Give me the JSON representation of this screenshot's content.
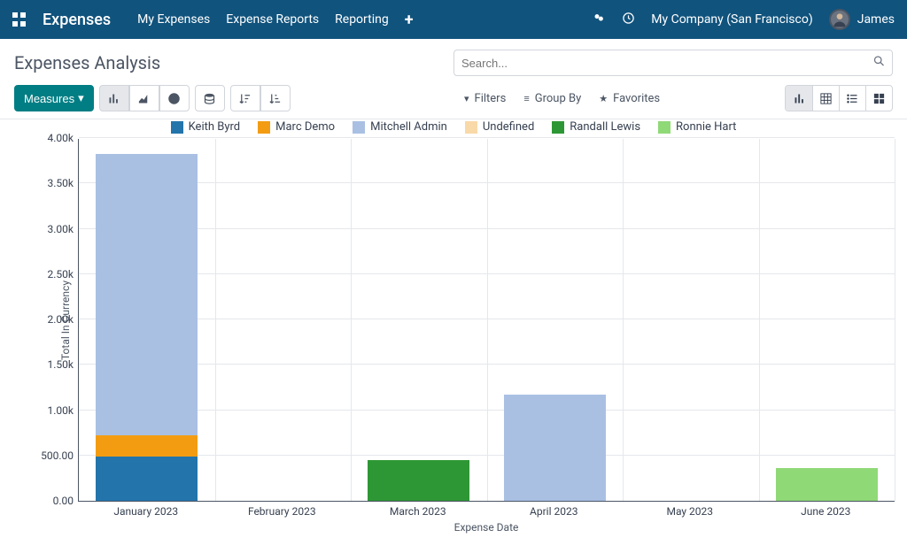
{
  "topnav": {
    "brand": "Expenses",
    "links": [
      "My Expenses",
      "Expense Reports",
      "Reporting"
    ],
    "company": "My Company (San Francisco)",
    "user": "James"
  },
  "controlpanel": {
    "title": "Expenses Analysis",
    "search_placeholder": "Search...",
    "measures_label": "Measures",
    "filters_label": "Filters",
    "groupby_label": "Group By",
    "favorites_label": "Favorites"
  },
  "colors": {
    "keith_byrd": "#2374ab",
    "marc_demo": "#f39c12",
    "mitchell_admin": "#a9c0e3",
    "undefined": "#f9d9a8",
    "randall_lewis": "#2e9735",
    "ronnie_hart": "#90d977"
  },
  "chart_data": {
    "type": "bar",
    "stacked": true,
    "title": "",
    "xlabel": "Expense Date",
    "ylabel": "Total In Currency",
    "ylim": [
      0,
      4000
    ],
    "ytick_step": 500,
    "ytick_labels": [
      "0.00",
      "500.00",
      "1.00k",
      "1.50k",
      "2.00k",
      "2.50k",
      "3.00k",
      "3.50k",
      "4.00k"
    ],
    "categories": [
      "January 2023",
      "February 2023",
      "March 2023",
      "April 2023",
      "May 2023",
      "June 2023"
    ],
    "series": [
      {
        "name": "Keith Byrd",
        "color_key": "keith_byrd",
        "values": [
          490,
          0,
          0,
          0,
          0,
          0
        ]
      },
      {
        "name": "Marc Demo",
        "color_key": "marc_demo",
        "values": [
          230,
          0,
          0,
          0,
          0,
          0
        ]
      },
      {
        "name": "Mitchell Admin",
        "color_key": "mitchell_admin",
        "values": [
          3100,
          0,
          0,
          1170,
          0,
          0
        ]
      },
      {
        "name": "Undefined",
        "color_key": "undefined",
        "values": [
          0,
          0,
          0,
          0,
          0,
          0
        ]
      },
      {
        "name": "Randall Lewis",
        "color_key": "randall_lewis",
        "values": [
          0,
          0,
          450,
          0,
          0,
          0
        ]
      },
      {
        "name": "Ronnie Hart",
        "color_key": "ronnie_hart",
        "values": [
          0,
          0,
          0,
          0,
          0,
          360
        ]
      }
    ]
  }
}
